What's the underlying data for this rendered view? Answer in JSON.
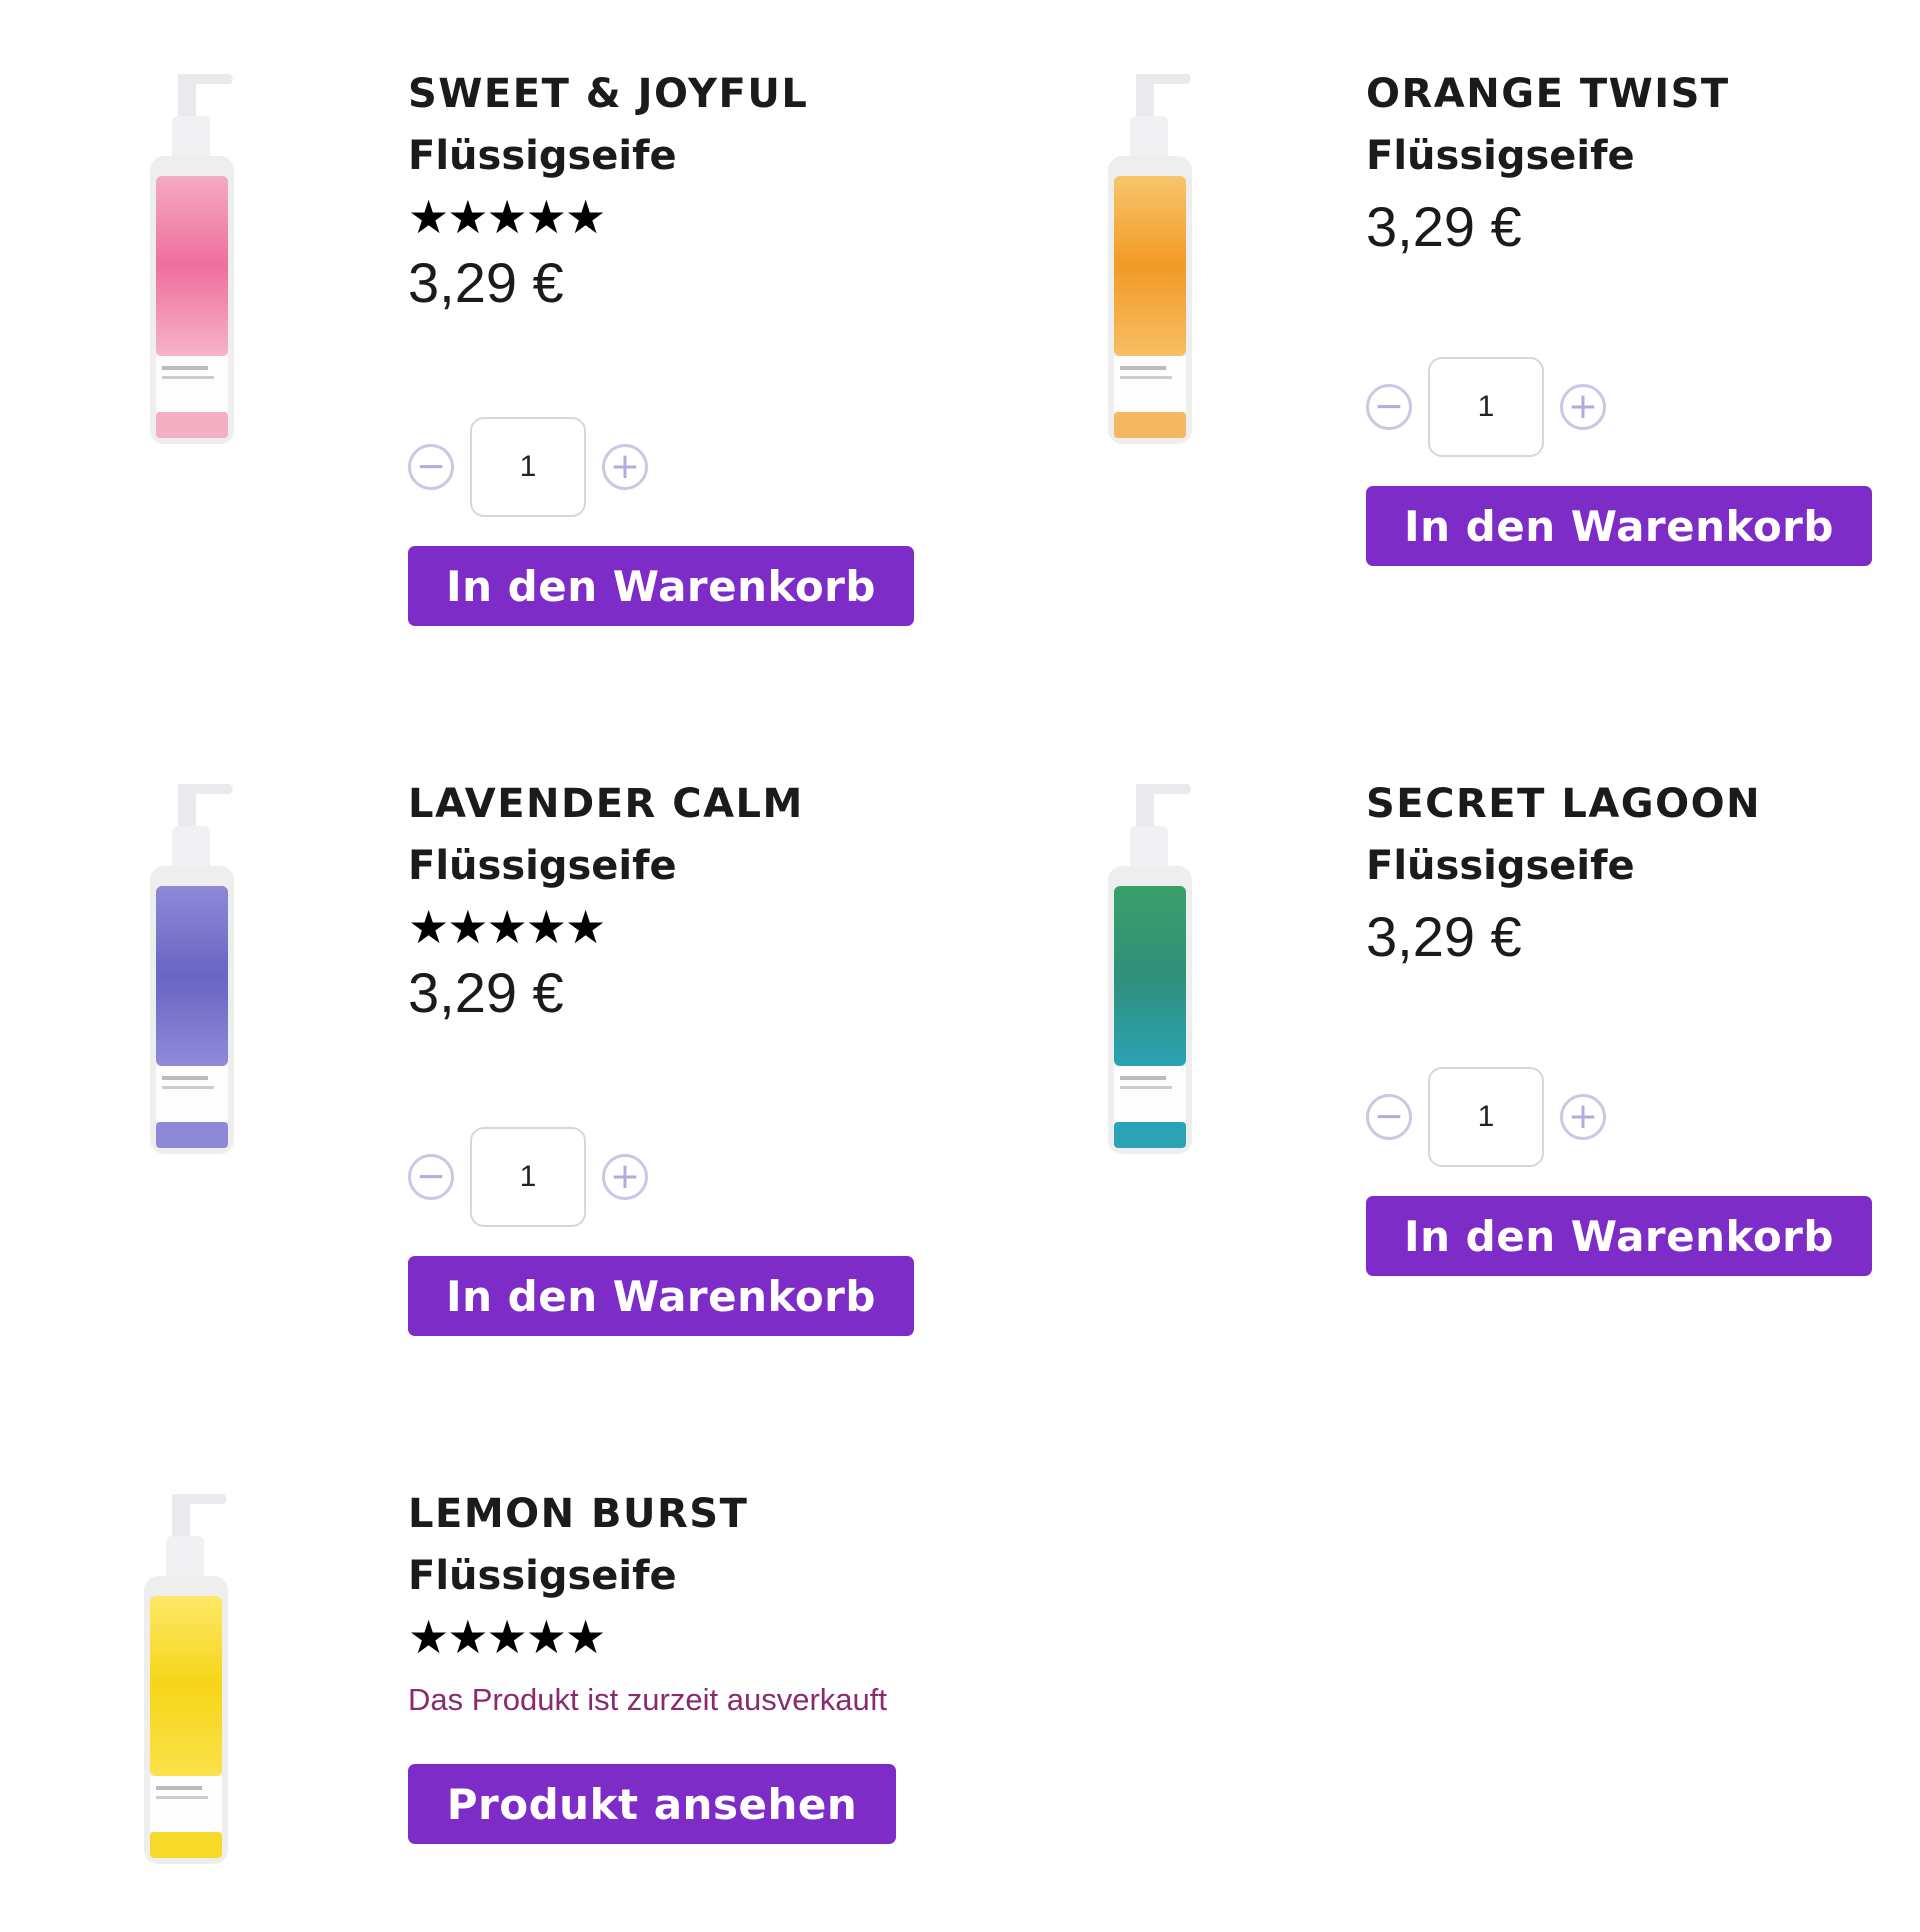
{
  "colors": {
    "accent": "#7e2cc8",
    "stepper": "#cfc6e6",
    "soldout_text": "#8a2b70"
  },
  "products": [
    {
      "name": "SWEET & JOYFUL",
      "type": "Flüssigseife",
      "stars": "★★★★★",
      "price": "3,29 €",
      "quantity": "1",
      "button": "In den Warenkorb",
      "image_icon": "pink-soap-bottle-icon"
    },
    {
      "name": "ORANGE TWIST",
      "type": "Flüssigseife",
      "price": "3,29 €",
      "quantity": "1",
      "button": "In den Warenkorb",
      "image_icon": "orange-soap-bottle-icon"
    },
    {
      "name": "LAVENDER CALM",
      "type": "Flüssigseife",
      "stars": "★★★★★",
      "price": "3,29 €",
      "quantity": "1",
      "button": "In den Warenkorb",
      "image_icon": "lavender-soap-bottle-icon"
    },
    {
      "name": "SECRET LAGOON",
      "type": "Flüssigseife",
      "price": "3,29 €",
      "quantity": "1",
      "button": "In den Warenkorb",
      "image_icon": "green-soap-bottle-icon"
    },
    {
      "name": "LEMON BURST",
      "type": "Flüssigseife",
      "stars": "★★★★★",
      "status": "Das Produkt ist zurzeit ausverkauft",
      "button": "Produkt ansehen",
      "image_icon": "lemon-soap-bottle-icon"
    }
  ],
  "stepper": {
    "minus": "−",
    "plus": "+"
  }
}
